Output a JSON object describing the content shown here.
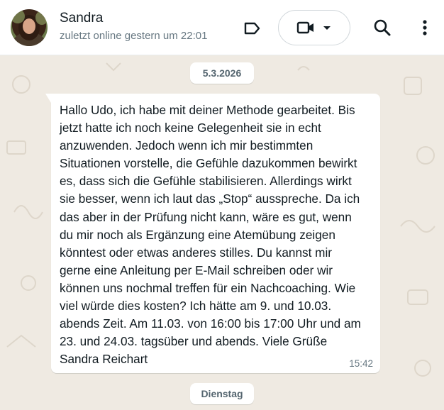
{
  "header": {
    "contact_name": "Sandra",
    "status": "zuletzt online gestern um 22:01",
    "icons": [
      "avatar",
      "label-icon",
      "video-call-icon",
      "chevron-down-icon",
      "search-icon",
      "more-vert-icon"
    ]
  },
  "chat": {
    "date_separator_1": "5.3.2026",
    "message": {
      "text": "Hallo Udo, ich habe mit deiner Methode gearbeitet. Bis\njetzt hatte ich noch keine Gelegenheit sie in echt\nanzuwenden. Jedoch wenn ich mir bestimmten\nSituationen vorstelle, die Gefühle dazukommen bewirkt\nes, dass sich die Gefühle stabilisieren. Allerdings wirkt\nsie besser, wenn ich laut das „Stop“ ausspreche. Da ich\ndas aber in der Prüfung nicht kann, wäre es gut, wenn\ndu mir noch als Ergänzung eine Atemübung zeigen\nkönntest oder etwas anderes stilles. Du kannst mir\ngerne eine Anleitung per E-Mail schreiben oder wir\nkönnen uns nochmal treffen für ein Nachcoaching. Wie\nviel würde dies kosten? Ich hätte am 9. und 10.03.\nabends Zeit. Am 11.03. von 16:00 bis 17:00 Uhr und am\n23. und 24.03. tagsüber und abends. Viele Grüße\nSandra Reichart",
      "time": "15:42"
    },
    "date_separator_2": "Dienstag"
  },
  "colors": {
    "header_bg": "#ffffff",
    "chat_bg": "#efeae2",
    "bubble_bg": "#ffffff",
    "text_primary": "#111b21",
    "text_secondary": "#667781",
    "icon": "#111b21"
  }
}
